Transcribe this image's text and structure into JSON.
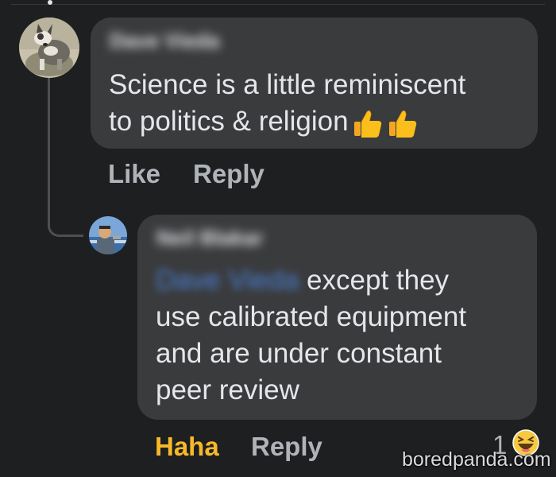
{
  "comment": {
    "author": "Dave Vieda",
    "text_line1": "Science is a little reminiscent",
    "text_line2": "to politics & religion",
    "emoji": "thumbs-up-icon",
    "actions": {
      "like": "Like",
      "reply": "Reply"
    }
  },
  "reply": {
    "author": "Neil Blakar",
    "mention": "Dave Vieda",
    "text_line1_rest": " except they",
    "text_line2": "use calibrated equipment",
    "text_line3": "and are under constant",
    "text_line4": "peer review",
    "actions": {
      "reaction": "Haha",
      "reply": "Reply"
    },
    "reaction_count": "1",
    "reaction_icon": "haha-emoji-icon"
  },
  "watermark": "boredpanda.com",
  "colors": {
    "background": "#1e1f21",
    "bubble": "#3a3b3c",
    "text": "#e4e6eb",
    "muted": "#b0b3b8",
    "haha": "#f7b928",
    "mention": "#4a7fd6"
  }
}
